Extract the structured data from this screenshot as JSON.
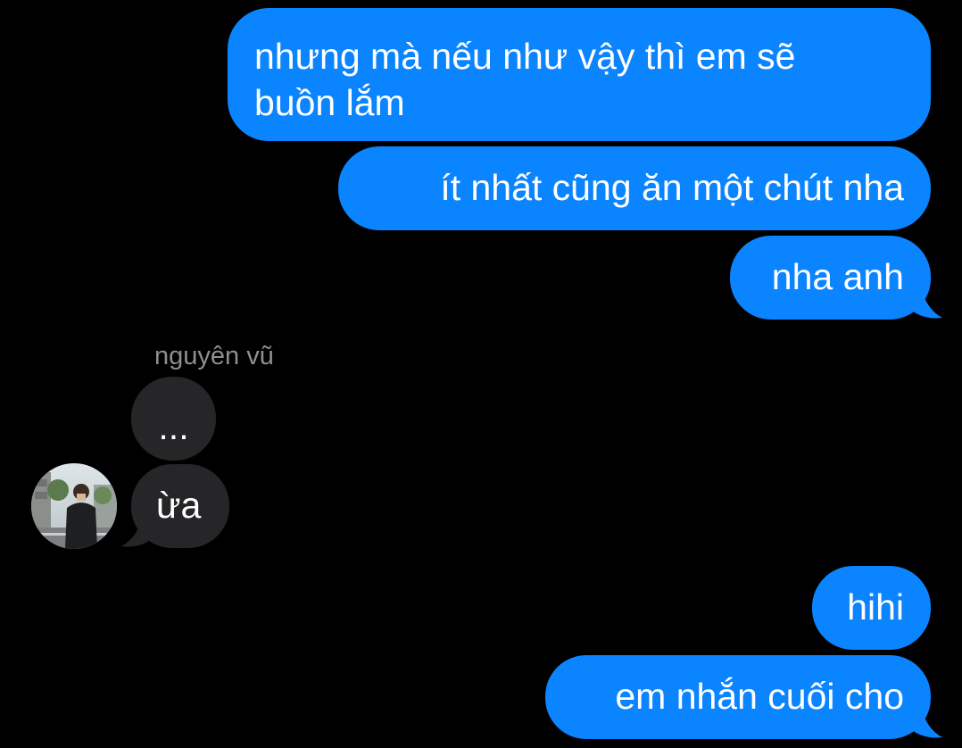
{
  "conversation": {
    "colors": {
      "background": "#000000",
      "sent_bubble": "#0a84ff",
      "received_bubble": "#262628",
      "text": "#ffffff",
      "sender_name": "#8e8e93"
    },
    "sent_group_1": [
      {
        "line1": "nhưng mà nếu như vậy thì em sẽ",
        "line2": "buồn lắm"
      },
      {
        "text": "ít nhất cũng ăn một chút nha"
      },
      {
        "text": "nha anh"
      }
    ],
    "received_group": {
      "sender_name": "nguyên vũ",
      "avatar_icon": "profile-photo-icon",
      "messages": [
        {
          "text": "..."
        },
        {
          "text": "ừa"
        }
      ]
    },
    "sent_group_2": [
      {
        "text": "hihi"
      },
      {
        "text": "em nhắn cuối cho"
      }
    ]
  }
}
